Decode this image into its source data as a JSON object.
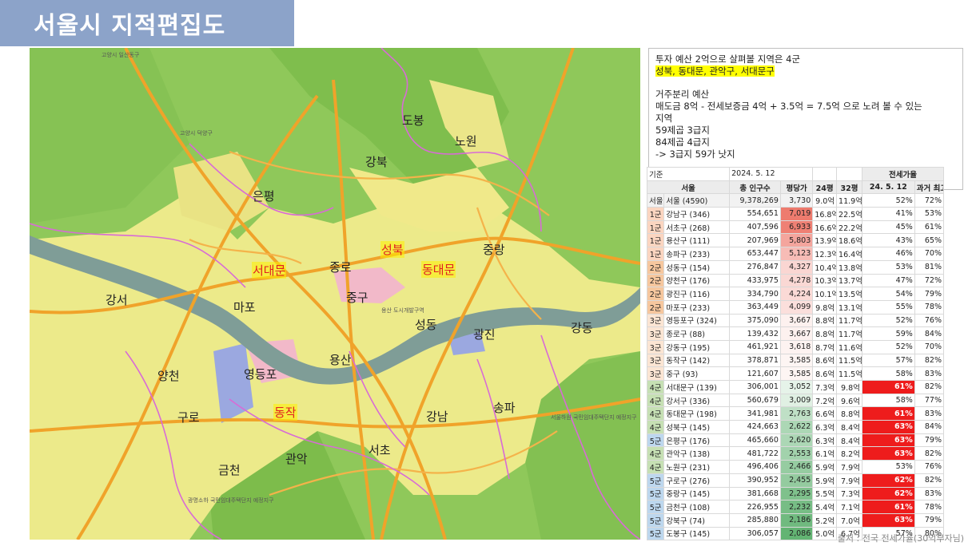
{
  "page": {
    "title": "서울시 지적편집도",
    "source": "출처 : 전국 전세가율(30억부자님)"
  },
  "map": {
    "districts": [
      {
        "id": "dobong",
        "name": "도봉",
        "highlight": false
      },
      {
        "id": "nowon",
        "name": "노원",
        "highlight": false
      },
      {
        "id": "gangbuk",
        "name": "강북",
        "highlight": false
      },
      {
        "id": "eunpyeong",
        "name": "은평",
        "highlight": false
      },
      {
        "id": "seongbuk",
        "name": "성북",
        "highlight": true
      },
      {
        "id": "jungnang",
        "name": "중랑",
        "highlight": false
      },
      {
        "id": "seodaemun",
        "name": "서대문",
        "highlight": true
      },
      {
        "id": "jongno",
        "name": "종로",
        "highlight": false
      },
      {
        "id": "dongdaemun",
        "name": "동대문",
        "highlight": true
      },
      {
        "id": "gangseo",
        "name": "강서",
        "highlight": false
      },
      {
        "id": "mapo",
        "name": "마포",
        "highlight": false
      },
      {
        "id": "junggu",
        "name": "중구",
        "highlight": false
      },
      {
        "id": "seongdong",
        "name": "성동",
        "highlight": false
      },
      {
        "id": "gwangjin",
        "name": "광진",
        "highlight": false
      },
      {
        "id": "gangdong",
        "name": "강동",
        "highlight": false
      },
      {
        "id": "yangcheon",
        "name": "양천",
        "highlight": false
      },
      {
        "id": "yeongdeungpo",
        "name": "영등포",
        "highlight": false
      },
      {
        "id": "yongsan",
        "name": "용산",
        "highlight": false
      },
      {
        "id": "guro",
        "name": "구로",
        "highlight": false
      },
      {
        "id": "dongjak",
        "name": "동작",
        "highlight": true
      },
      {
        "id": "gangnam",
        "name": "강남",
        "highlight": false
      },
      {
        "id": "songpa",
        "name": "송파",
        "highlight": false
      },
      {
        "id": "seocho",
        "name": "서초",
        "highlight": false
      },
      {
        "id": "geumcheon",
        "name": "금천",
        "highlight": false
      },
      {
        "id": "gwanak",
        "name": "관악",
        "highlight": false
      }
    ],
    "small_labels": [
      {
        "id": "s1",
        "text": "고양시 일산동구"
      },
      {
        "id": "s2",
        "text": "고양시 덕양구"
      },
      {
        "id": "s3",
        "text": "광명소하 국민임대주택단지 예정지구"
      },
      {
        "id": "s4",
        "text": "서울하원 국민임대주택단지 예정지구"
      },
      {
        "id": "s5",
        "text": "용산 도시개발구역"
      }
    ]
  },
  "info": {
    "line1": "투자 예산 2억으로 살펴볼 지역은 4군",
    "line2": "성북, 동대문, 관악구, 서대문구",
    "line3": "거주분리 예산",
    "line4": "매도금 8억 - 전세보증금  4억 + 3.5억 = 7.5억 으로 노려 볼 수 있는",
    "line5": "지역",
    "line6": "59제곱 3급지",
    "line7": "84제곱 4급지",
    "line8": "-> 3급지 59가 낫지"
  },
  "table": {
    "base_label": "기준",
    "base_date": "2024. 5. 12",
    "jeonse_title": "전세가율",
    "headers": {
      "region": "서울",
      "pop": "총 인구수",
      "ppy": "평당가",
      "p24": "24평",
      "p32": "32평",
      "rate": "24. 5. 12",
      "max": "과거 최고"
    },
    "rows": [
      {
        "grp": "서울",
        "name": "서울 (4590)",
        "pop": "9,378,269",
        "ppy": "3,730",
        "p24": "9.0억",
        "p32": "11.9억",
        "rate": "52%",
        "max": "72%",
        "grp_color": "#f2f2f2",
        "ppy_color": "#f2f2f2",
        "rate_hl": false
      },
      {
        "grp": "1군",
        "name": "강남구 (346)",
        "pop": "554,651",
        "ppy": "7,019",
        "p24": "16.8억",
        "p32": "22.5억",
        "rate": "41%",
        "max": "53%",
        "grp_color": "#fbd5c0",
        "ppy_color": "#ee7b6e",
        "rate_hl": false
      },
      {
        "grp": "1군",
        "name": "서초구 (268)",
        "pop": "407,596",
        "ppy": "6,933",
        "p24": "16.6억",
        "p32": "22.2억",
        "rate": "45%",
        "max": "61%",
        "grp_color": "#fbd5c0",
        "ppy_color": "#ef8074",
        "rate_hl": false
      },
      {
        "grp": "1군",
        "name": "용산구 (111)",
        "pop": "207,969",
        "ppy": "5,803",
        "p24": "13.9억",
        "p32": "18.6억",
        "rate": "43%",
        "max": "65%",
        "grp_color": "#fbd5c0",
        "ppy_color": "#f4a59d",
        "rate_hl": false
      },
      {
        "grp": "1군",
        "name": "송파구 (233)",
        "pop": "653,447",
        "ppy": "5,123",
        "p24": "12.3억",
        "p32": "16.4억",
        "rate": "46%",
        "max": "70%",
        "grp_color": "#fbd5c0",
        "ppy_color": "#f7bcb6",
        "rate_hl": false
      },
      {
        "grp": "2군",
        "name": "성동구 (154)",
        "pop": "276,847",
        "ppy": "4,327",
        "p24": "10.4억",
        "p32": "13.8억",
        "rate": "53%",
        "max": "81%",
        "grp_color": "#f6c79e",
        "ppy_color": "#fad6d2",
        "rate_hl": false
      },
      {
        "grp": "2군",
        "name": "양천구 (176)",
        "pop": "433,975",
        "ppy": "4,278",
        "p24": "10.3억",
        "p32": "13.7억",
        "rate": "47%",
        "max": "72%",
        "grp_color": "#f6c79e",
        "ppy_color": "#fad8d4",
        "rate_hl": false
      },
      {
        "grp": "2군",
        "name": "광진구 (116)",
        "pop": "334,790",
        "ppy": "4,224",
        "p24": "10.1억",
        "p32": "13.5억",
        "rate": "54%",
        "max": "79%",
        "grp_color": "#f6c79e",
        "ppy_color": "#fbdad6",
        "rate_hl": false
      },
      {
        "grp": "2군",
        "name": "마포구 (233)",
        "pop": "363,449",
        "ppy": "4,099",
        "p24": "9.8억",
        "p32": "13.1억",
        "rate": "55%",
        "max": "78%",
        "grp_color": "#f6c79e",
        "ppy_color": "#fbdfdc",
        "rate_hl": false
      },
      {
        "grp": "3군",
        "name": "영등포구 (324)",
        "pop": "375,090",
        "ppy": "3,667",
        "p24": "8.8억",
        "p32": "11.7억",
        "rate": "52%",
        "max": "76%",
        "grp_color": "#fbe5d3",
        "ppy_color": "#fdf1ef",
        "rate_hl": false
      },
      {
        "grp": "3군",
        "name": "종로구 (88)",
        "pop": "139,432",
        "ppy": "3,667",
        "p24": "8.8억",
        "p32": "11.7억",
        "rate": "59%",
        "max": "84%",
        "grp_color": "#fbe5d3",
        "ppy_color": "#fdf1ef",
        "rate_hl": false
      },
      {
        "grp": "3군",
        "name": "강동구 (195)",
        "pop": "461,921",
        "ppy": "3,618",
        "p24": "8.7억",
        "p32": "11.6억",
        "rate": "52%",
        "max": "70%",
        "grp_color": "#fbe5d3",
        "ppy_color": "#fdf3f1",
        "rate_hl": false
      },
      {
        "grp": "3군",
        "name": "동작구 (142)",
        "pop": "378,871",
        "ppy": "3,585",
        "p24": "8.6억",
        "p32": "11.5억",
        "rate": "57%",
        "max": "82%",
        "grp_color": "#fbe5d3",
        "ppy_color": "#fdf5f3",
        "rate_hl": false
      },
      {
        "grp": "3군",
        "name": "중구 (93)",
        "pop": "121,607",
        "ppy": "3,585",
        "p24": "8.6억",
        "p32": "11.5억",
        "rate": "58%",
        "max": "83%",
        "grp_color": "#fbe5d3",
        "ppy_color": "#fdf5f3",
        "rate_hl": false
      },
      {
        "grp": "4군",
        "name": "서대문구 (139)",
        "pop": "306,001",
        "ppy": "3,052",
        "p24": "7.3억",
        "p32": "9.8억",
        "rate": "61%",
        "max": "82%",
        "grp_color": "#c6e0b4",
        "ppy_color": "#e6f3e9",
        "rate_hl": true
      },
      {
        "grp": "4군",
        "name": "강서구 (336)",
        "pop": "560,679",
        "ppy": "3,009",
        "p24": "7.2억",
        "p32": "9.6억",
        "rate": "58%",
        "max": "77%",
        "grp_color": "#c6e0b4",
        "ppy_color": "#e0f0e3",
        "rate_hl": false
      },
      {
        "grp": "4군",
        "name": "동대문구 (198)",
        "pop": "341,981",
        "ppy": "2,763",
        "p24": "6.6억",
        "p32": "8.8억",
        "rate": "61%",
        "max": "83%",
        "grp_color": "#c6e0b4",
        "ppy_color": "#bfe0c6",
        "rate_hl": true
      },
      {
        "grp": "4군",
        "name": "성북구 (145)",
        "pop": "424,663",
        "ppy": "2,622",
        "p24": "6.3억",
        "p32": "8.4억",
        "rate": "63%",
        "max": "84%",
        "grp_color": "#c6e0b4",
        "ppy_color": "#acd7b5",
        "rate_hl": true
      },
      {
        "grp": "5군",
        "name": "은평구 (176)",
        "pop": "465,660",
        "ppy": "2,620",
        "p24": "6.3억",
        "p32": "8.4억",
        "rate": "63%",
        "max": "79%",
        "grp_color": "#bdd7ee",
        "ppy_color": "#acd7b5",
        "rate_hl": true
      },
      {
        "grp": "4군",
        "name": "관악구 (138)",
        "pop": "481,722",
        "ppy": "2,553",
        "p24": "6.1억",
        "p32": "8.2억",
        "rate": "63%",
        "max": "82%",
        "grp_color": "#c6e0b4",
        "ppy_color": "#a2d2ac",
        "rate_hl": true
      },
      {
        "grp": "4군",
        "name": "노원구 (231)",
        "pop": "496,406",
        "ppy": "2,466",
        "p24": "5.9억",
        "p32": "7.9억",
        "rate": "53%",
        "max": "76%",
        "grp_color": "#c6e0b4",
        "ppy_color": "#96cca1",
        "rate_hl": false
      },
      {
        "grp": "5군",
        "name": "구로구 (276)",
        "pop": "390,952",
        "ppy": "2,455",
        "p24": "5.9억",
        "p32": "7.9억",
        "rate": "62%",
        "max": "82%",
        "grp_color": "#bdd7ee",
        "ppy_color": "#94cb9f",
        "rate_hl": true
      },
      {
        "grp": "5군",
        "name": "중랑구 (145)",
        "pop": "381,668",
        "ppy": "2,295",
        "p24": "5.5억",
        "p32": "7.3억",
        "rate": "62%",
        "max": "83%",
        "grp_color": "#bdd7ee",
        "ppy_color": "#7fc18c",
        "rate_hl": true
      },
      {
        "grp": "5군",
        "name": "금천구 (108)",
        "pop": "226,955",
        "ppy": "2,232",
        "p24": "5.4억",
        "p32": "7.1억",
        "rate": "61%",
        "max": "78%",
        "grp_color": "#bdd7ee",
        "ppy_color": "#77bd85",
        "rate_hl": true
      },
      {
        "grp": "5군",
        "name": "강북구 (74)",
        "pop": "285,880",
        "ppy": "2,186",
        "p24": "5.2억",
        "p32": "7.0억",
        "rate": "63%",
        "max": "79%",
        "grp_color": "#bdd7ee",
        "ppy_color": "#70ba7f",
        "rate_hl": true
      },
      {
        "grp": "5군",
        "name": "도봉구 (145)",
        "pop": "306,057",
        "ppy": "2,086",
        "p24": "5.0억",
        "p32": "6.7억",
        "rate": "57%",
        "max": "80%",
        "grp_color": "#bdd7ee",
        "ppy_color": "#63b473",
        "rate_hl": false
      }
    ]
  },
  "colors": {
    "title_bar": "#8ca3c9",
    "map_green": "#8fc85a",
    "map_urban": "#ecea8a",
    "road": "#f0a32a",
    "river": "#7f9d97",
    "boundary": "#d86bd6",
    "rate_red": "#ee1c1c"
  }
}
